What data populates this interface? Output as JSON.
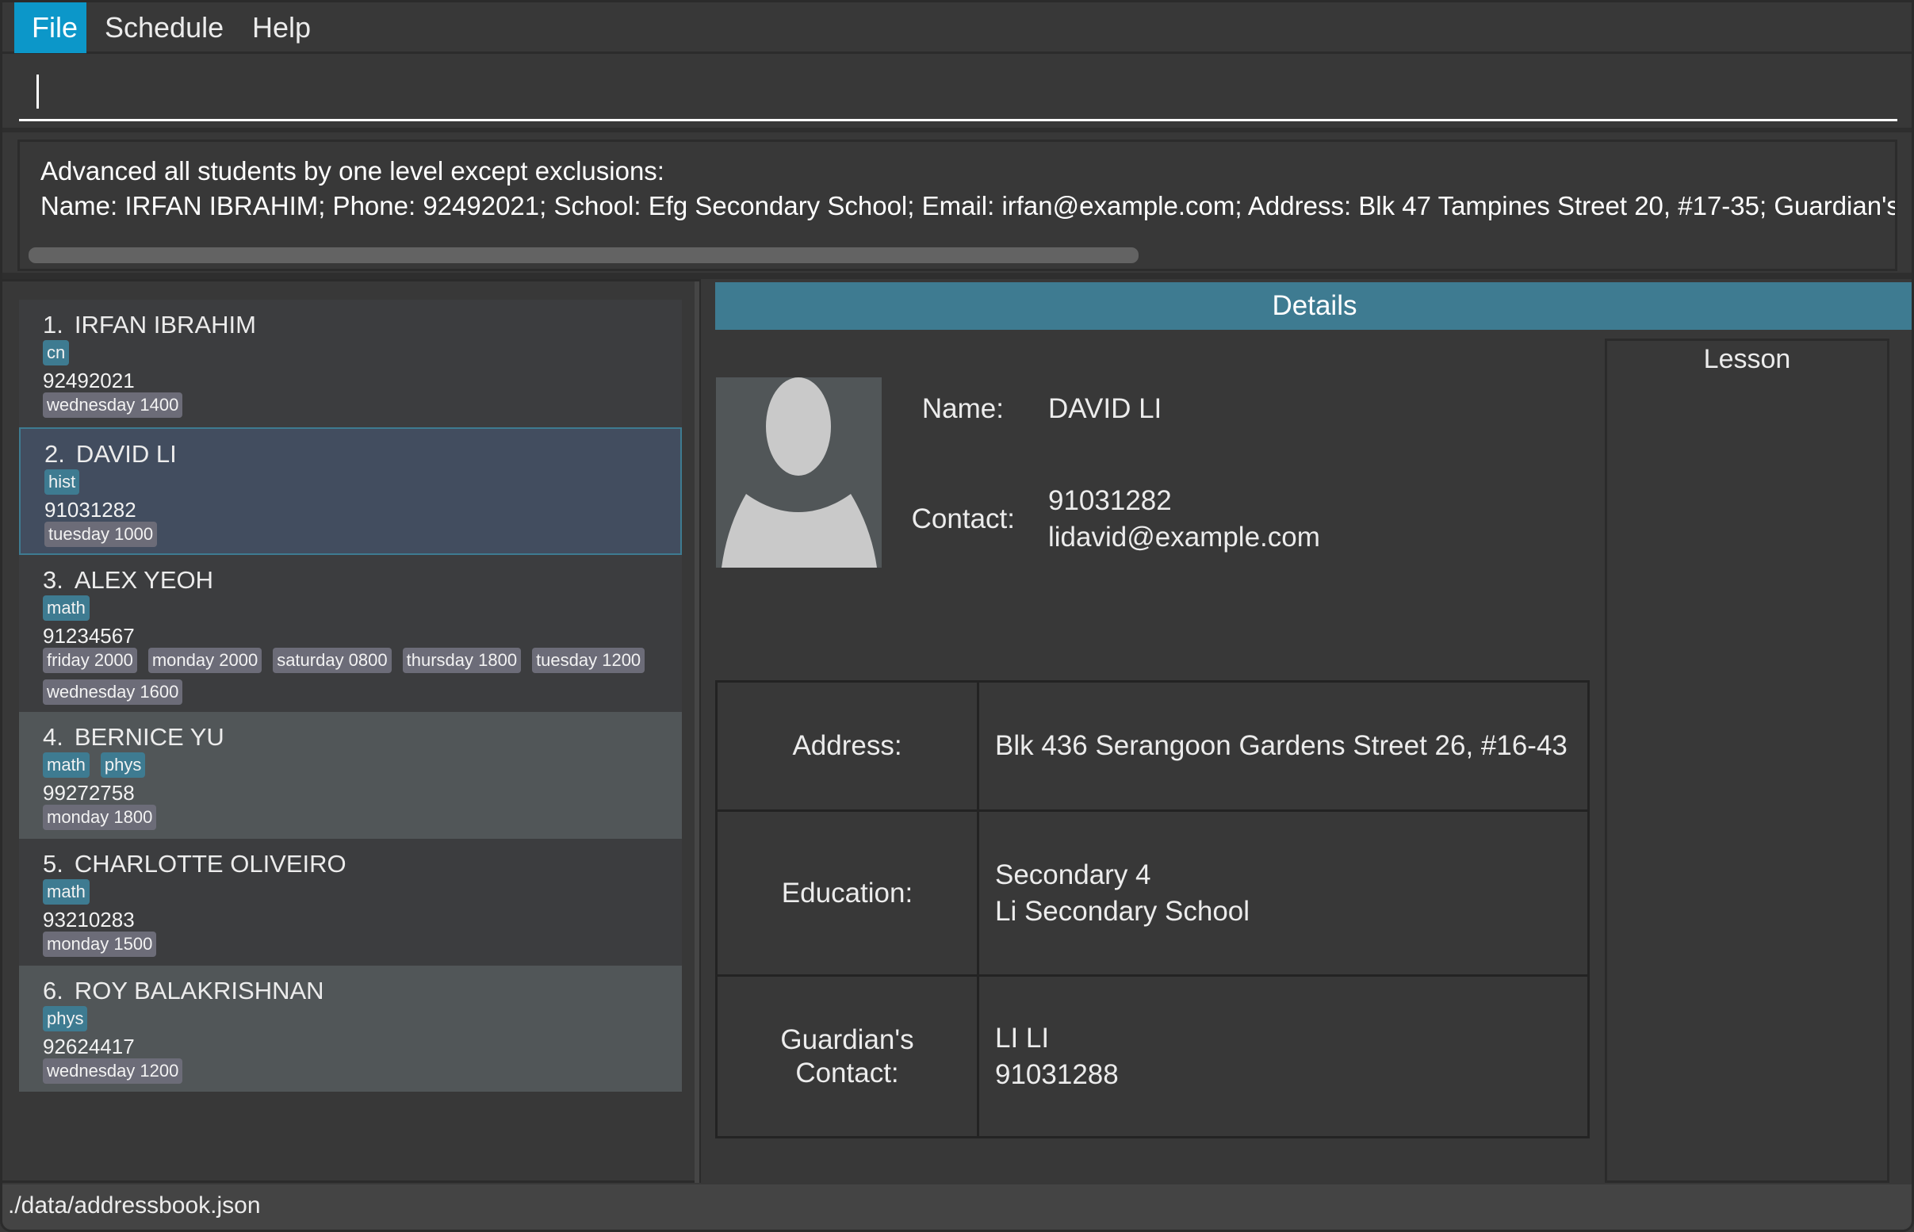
{
  "menu": {
    "items": [
      {
        "label": "File",
        "active": true
      },
      {
        "label": "Schedule",
        "active": false
      },
      {
        "label": "Help",
        "active": false
      }
    ]
  },
  "command_box": {
    "value": "",
    "placeholder": ""
  },
  "result_display": {
    "lines": [
      "Advanced all students by one level except exclusions:",
      "Name: IRFAN IBRAHIM; Phone: 92492021; School: Efg Secondary School; Email: irfan@example.com; Address: Blk 47 Tampines Street 20, #17-35; Guardian's Na"
    ]
  },
  "students": [
    {
      "index": "1.",
      "name": "IRFAN IBRAHIM",
      "subjects": [
        "cn"
      ],
      "phone": "92492021",
      "schedules": [
        "wednesday 1400"
      ],
      "selected": false
    },
    {
      "index": "2.",
      "name": "DAVID LI",
      "subjects": [
        "hist"
      ],
      "phone": "91031282",
      "schedules": [
        "tuesday 1000"
      ],
      "selected": true
    },
    {
      "index": "3.",
      "name": "ALEX YEOH",
      "subjects": [
        "math"
      ],
      "phone": "91234567",
      "schedules": [
        "friday 2000",
        "monday 2000",
        "saturday 0800",
        "thursday 1800",
        "tuesday 1200",
        "wednesday 1600"
      ],
      "selected": false
    },
    {
      "index": "4.",
      "name": "BERNICE YU",
      "subjects": [
        "math",
        "phys"
      ],
      "phone": "99272758",
      "schedules": [
        "monday 1800"
      ],
      "selected": false
    },
    {
      "index": "5.",
      "name": "CHARLOTTE OLIVEIRO",
      "subjects": [
        "math"
      ],
      "phone": "93210283",
      "schedules": [
        "monday 1500"
      ],
      "selected": false
    },
    {
      "index": "6.",
      "name": "ROY BALAKRISHNAN",
      "subjects": [
        "phys"
      ],
      "phone": "92624417",
      "schedules": [
        "wednesday 1200"
      ],
      "selected": false
    }
  ],
  "details": {
    "banner_title": "Details",
    "avatar_icon": "person-silhouette-icon",
    "name_label": "Name:",
    "name_value": "DAVID LI",
    "contact_label": "Contact:",
    "contact_phone": "91031282",
    "contact_email": "lidavid@example.com",
    "table": [
      {
        "label": "Address:",
        "values": [
          "Blk 436 Serangoon Gardens Street 26, #16-43"
        ]
      },
      {
        "label": "Education:",
        "values": [
          "Secondary 4",
          "Li Secondary School"
        ]
      },
      {
        "label": "Guardian's Contact:",
        "label_lines": [
          "Guardian's",
          "Contact:"
        ],
        "values": [
          "LI LI",
          "91031288"
        ]
      }
    ],
    "lesson_title": "Lesson"
  },
  "status_bar": {
    "path": "./data/addressbook.json"
  },
  "colors": {
    "accent": "#0c97c9",
    "banner": "#3e7b91",
    "subject_tag": "#3e7b91",
    "schedule_tag": "#6c6c78",
    "selected_card": "#424d5f",
    "background": "#383838"
  }
}
